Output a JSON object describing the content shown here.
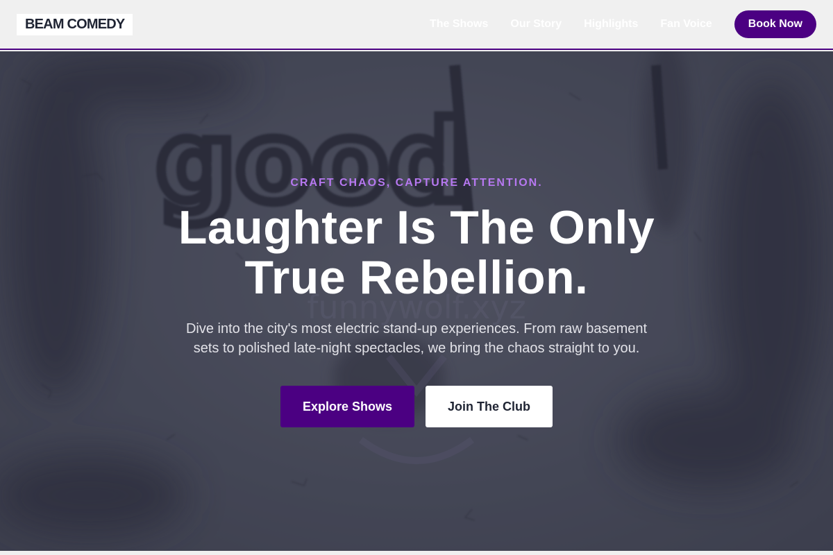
{
  "header": {
    "logo": "BEAM COMEDY",
    "nav": [
      {
        "label": "The Shows"
      },
      {
        "label": "Our Story"
      },
      {
        "label": "Highlights"
      },
      {
        "label": "Fan Voice"
      }
    ],
    "cta_label": "Book Now"
  },
  "hero": {
    "tagline": "CRAFT CHAOS, CAPTURE ATTENTION.",
    "headline": "Laughter Is The Only True Rebellion.",
    "subtext": "Dive into the city's most electric stand-up experiences. From raw basement sets to polished late-night spectacles, we bring the chaos straight to you.",
    "primary_button": "Explore Shows",
    "secondary_button": "Join The Club",
    "background_graffiti": "good",
    "watermark": "funnywolf.xyz"
  },
  "colors": {
    "brand": "#4b0082",
    "tagline": "#b678f0",
    "nav_background": "#f0f0f0",
    "hero_overlay": "#2c2e3e"
  }
}
